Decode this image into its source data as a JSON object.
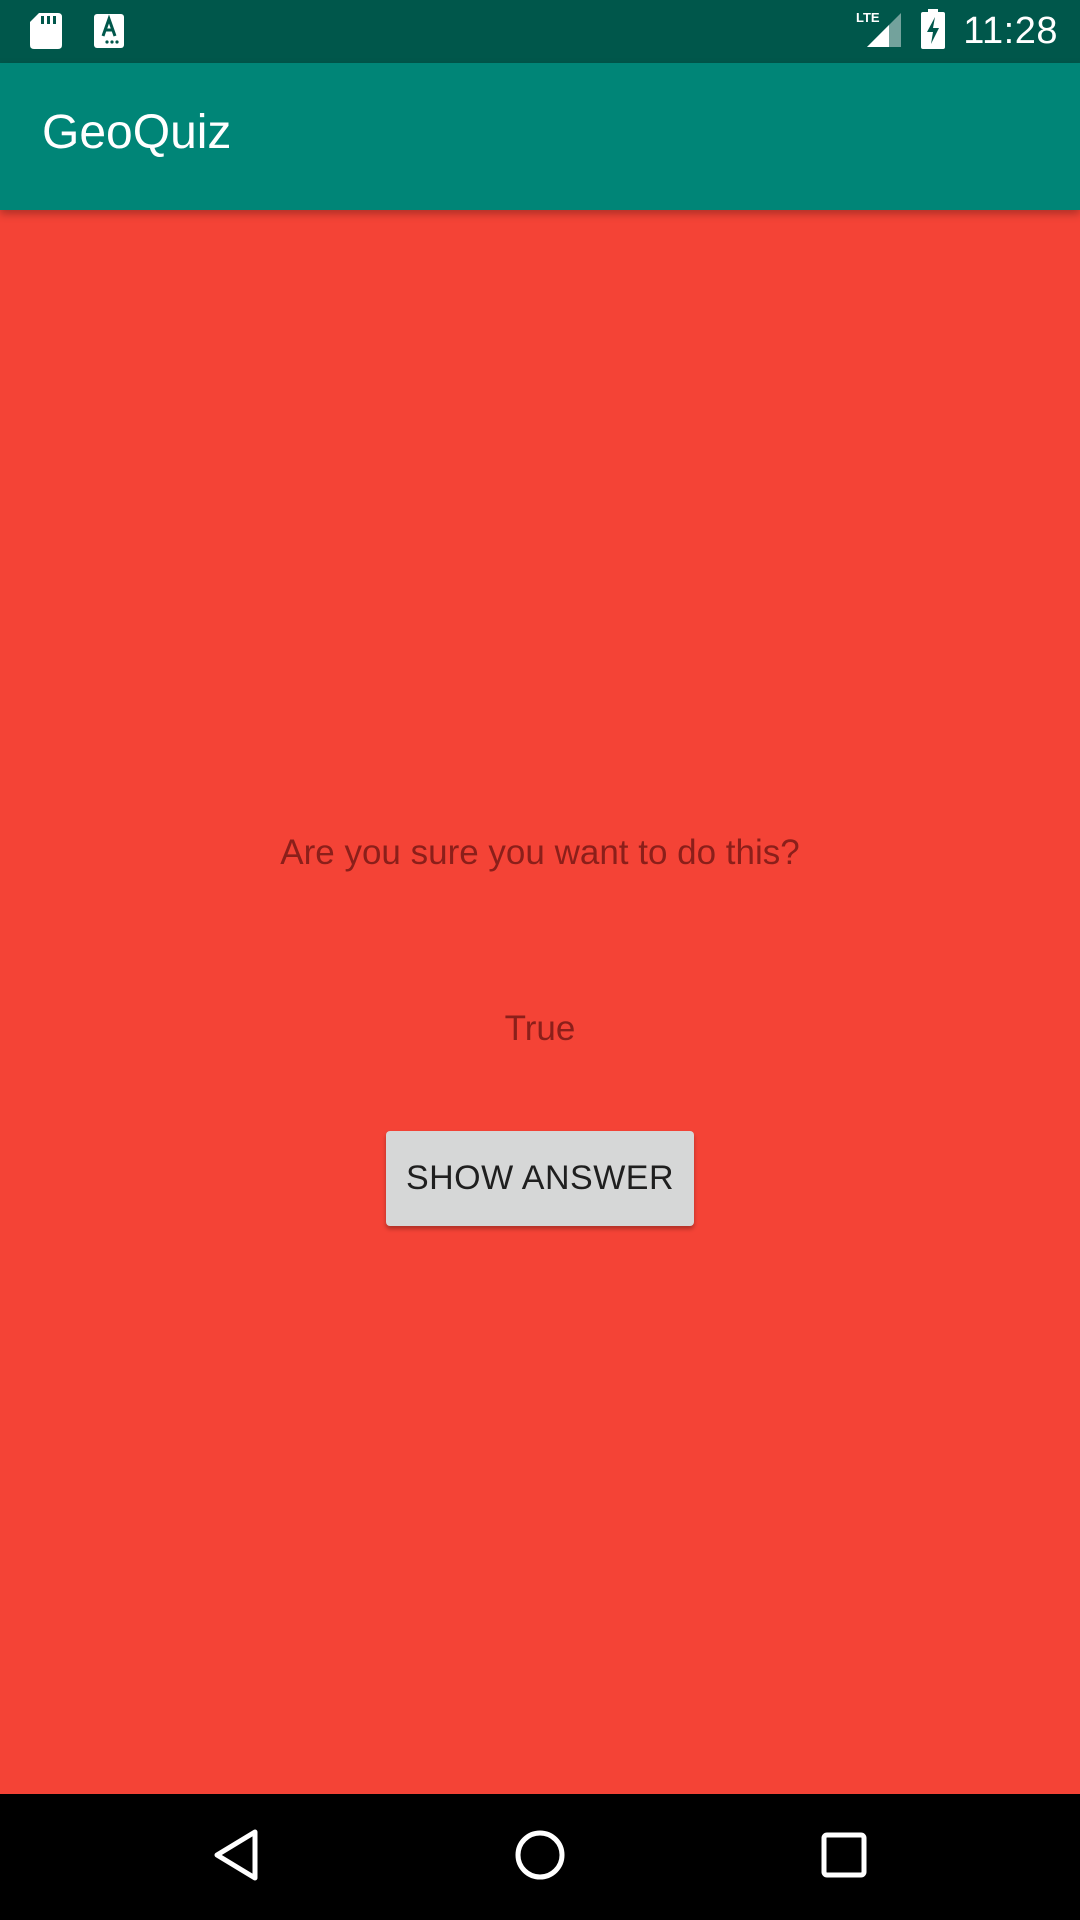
{
  "status_bar": {
    "time": "11:28",
    "network": "LTE",
    "icons": [
      "sd-card-icon",
      "text-a-icon",
      "lte-signal-icon",
      "battery-charging-icon"
    ]
  },
  "app_bar": {
    "title": "GeoQuiz",
    "color": "#008577"
  },
  "content": {
    "background_color": "#f44336",
    "warning_text": "Are you sure you want to do this?",
    "answer_text": "True",
    "show_answer_label": "SHOW ANSWER"
  },
  "nav_bar": {
    "icons": [
      "back-icon",
      "home-icon",
      "recents-icon"
    ]
  }
}
